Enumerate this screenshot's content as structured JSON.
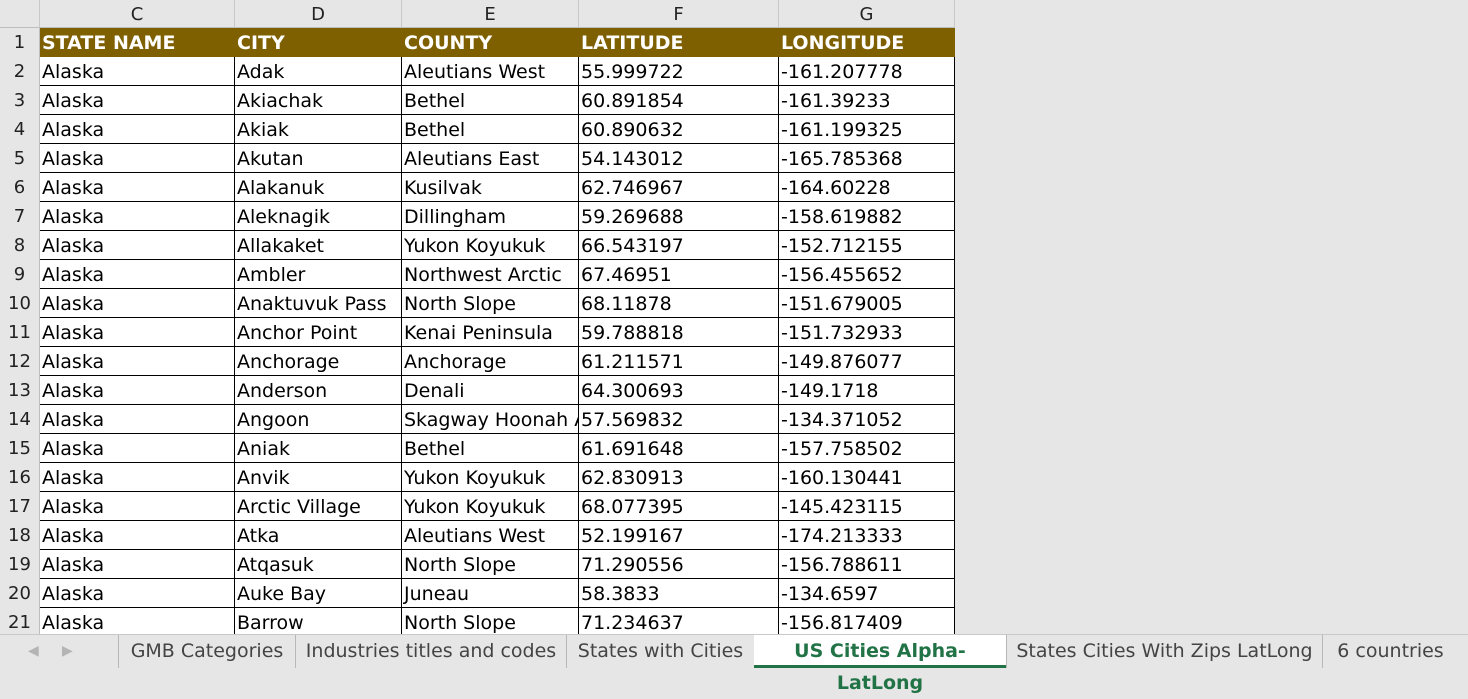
{
  "columns": [
    "C",
    "D",
    "E",
    "F",
    "G"
  ],
  "header_row": {
    "row_num": "1",
    "cells": [
      "STATE NAME",
      "CITY",
      "COUNTY",
      "LATITUDE",
      "LONGITUDE"
    ]
  },
  "rows": [
    {
      "n": "2",
      "cells": [
        "Alaska",
        "Adak",
        "Aleutians West",
        "55.999722",
        "-161.207778"
      ]
    },
    {
      "n": "3",
      "cells": [
        "Alaska",
        "Akiachak",
        "Bethel",
        "60.891854",
        "-161.39233"
      ]
    },
    {
      "n": "4",
      "cells": [
        "Alaska",
        "Akiak",
        "Bethel",
        "60.890632",
        "-161.199325"
      ]
    },
    {
      "n": "5",
      "cells": [
        "Alaska",
        "Akutan",
        "Aleutians East",
        "54.143012",
        "-165.785368"
      ]
    },
    {
      "n": "6",
      "cells": [
        "Alaska",
        "Alakanuk",
        "Kusilvak",
        "62.746967",
        "-164.60228"
      ]
    },
    {
      "n": "7",
      "cells": [
        "Alaska",
        "Aleknagik",
        "Dillingham",
        "59.269688",
        "-158.619882"
      ]
    },
    {
      "n": "8",
      "cells": [
        "Alaska",
        "Allakaket",
        "Yukon Koyukuk",
        "66.543197",
        "-152.712155"
      ]
    },
    {
      "n": "9",
      "cells": [
        "Alaska",
        "Ambler",
        "Northwest Arctic",
        "67.46951",
        "-156.455652"
      ]
    },
    {
      "n": "10",
      "cells": [
        "Alaska",
        "Anaktuvuk Pass",
        "North Slope",
        "68.11878",
        "-151.679005"
      ]
    },
    {
      "n": "11",
      "cells": [
        "Alaska",
        "Anchor Point",
        "Kenai Peninsula",
        "59.788818",
        "-151.732933"
      ]
    },
    {
      "n": "12",
      "cells": [
        "Alaska",
        "Anchorage",
        "Anchorage",
        "61.211571",
        "-149.876077"
      ]
    },
    {
      "n": "13",
      "cells": [
        "Alaska",
        "Anderson",
        "Denali",
        "64.300693",
        "-149.1718"
      ]
    },
    {
      "n": "14",
      "cells": [
        "Alaska",
        "Angoon",
        "Skagway Hoonah A",
        "57.569832",
        "-134.371052"
      ]
    },
    {
      "n": "15",
      "cells": [
        "Alaska",
        "Aniak",
        "Bethel",
        "61.691648",
        "-157.758502"
      ]
    },
    {
      "n": "16",
      "cells": [
        "Alaska",
        "Anvik",
        "Yukon Koyukuk",
        "62.830913",
        "-160.130441"
      ]
    },
    {
      "n": "17",
      "cells": [
        "Alaska",
        "Arctic Village",
        "Yukon Koyukuk",
        "68.077395",
        "-145.423115"
      ]
    },
    {
      "n": "18",
      "cells": [
        "Alaska",
        "Atka",
        "Aleutians West",
        "52.199167",
        "-174.213333"
      ]
    },
    {
      "n": "19",
      "cells": [
        "Alaska",
        "Atqasuk",
        "North Slope",
        "71.290556",
        "-156.788611"
      ]
    },
    {
      "n": "20",
      "cells": [
        "Alaska",
        "Auke Bay",
        "Juneau",
        "58.3833",
        "-134.6597"
      ]
    },
    {
      "n": "21",
      "cells": [
        "Alaska",
        "Barrow",
        "North Slope",
        "71.234637",
        "-156.817409"
      ]
    }
  ],
  "tabs": [
    {
      "label": "GMB Categories",
      "active": false
    },
    {
      "label": "Industries titles and codes",
      "active": false
    },
    {
      "label": "States with Cities",
      "active": false
    },
    {
      "label": "US Cities Alpha-LatLong",
      "active": true
    },
    {
      "label": "States Cities With Zips LatLong",
      "active": false
    },
    {
      "label": "6 countries",
      "active": false
    }
  ],
  "nav_icons": [
    "chevron-left-icon",
    "chevron-right-icon"
  ],
  "colors": {
    "header_fill": "#7f6000",
    "active_tab": "#217346"
  }
}
